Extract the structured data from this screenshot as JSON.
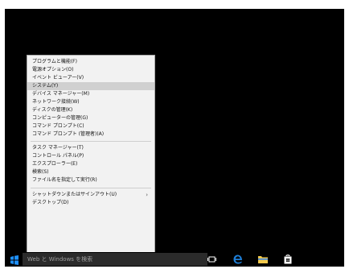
{
  "context_menu": {
    "items": [
      {
        "label": "プログラムと機能(F)"
      },
      {
        "label": "電源オプション(O)"
      },
      {
        "label": "イベント ビューアー(V)"
      },
      {
        "label": "システム(Y)"
      },
      {
        "label": "デバイス マネージャー(M)"
      },
      {
        "label": "ネットワーク接続(W)"
      },
      {
        "label": "ディスクの管理(K)"
      },
      {
        "label": "コンピューターの管理(G)"
      },
      {
        "label": "コマンド プロンプト(C)"
      },
      {
        "label": "コマンド プロンプト (管理者)(A)"
      },
      {
        "label": "タスク マネージャー(T)"
      },
      {
        "label": "コントロール パネル(P)"
      },
      {
        "label": "エクスプローラー(E)"
      },
      {
        "label": "検索(S)"
      },
      {
        "label": "ファイル名を指定して実行(R)"
      },
      {
        "label": "シャットダウンまたはサインアウト(U)"
      },
      {
        "label": "デスクトップ(D)"
      }
    ],
    "submenu_arrow": "›"
  },
  "taskbar": {
    "search_text": "Web と Windows を検索",
    "icons": [
      "windows-start-icon",
      "task-view-icon",
      "edge-icon",
      "file-explorer-icon",
      "store-icon"
    ]
  },
  "colors": {
    "desktop": "#000000",
    "menu_bg": "#f2f2f2",
    "highlight": "#d0d0d0",
    "start_blue": "#1e90ff",
    "edge_blue": "#1e7fd8",
    "folder_yellow": "#f2c94c"
  }
}
